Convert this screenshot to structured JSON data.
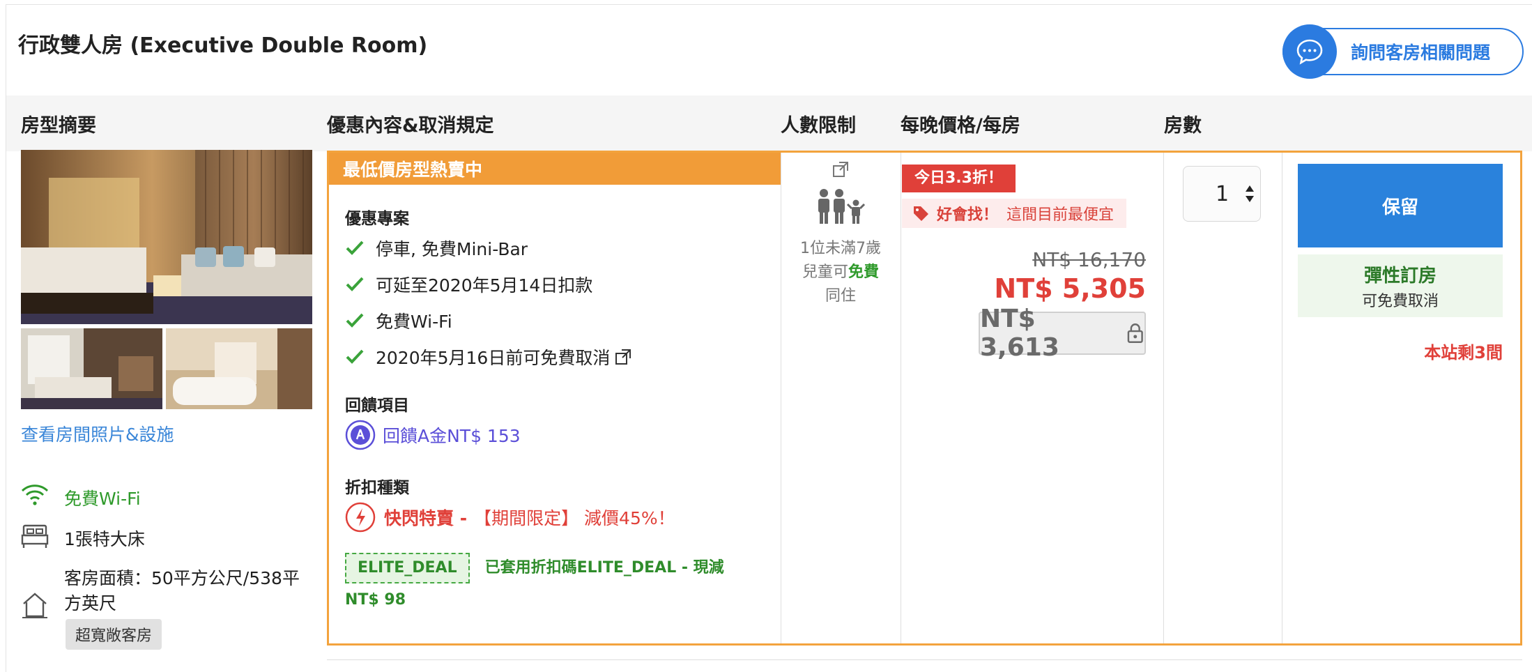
{
  "room": {
    "title": "行政雙人房 (Executive Double Room)",
    "ask_label": "詢問客房相關問題"
  },
  "columns": {
    "summary": "房型摘要",
    "offers": "優惠內容&取消規定",
    "persons": "人數限制",
    "price": "每晚價格/每房",
    "rooms": "房數"
  },
  "summary": {
    "view_photos": "查看房間照片&設施",
    "amenities": [
      "免費Wi-Fi",
      "1張特大床",
      "客房面積：50平方公尺/538平方英尺"
    ],
    "area_tag": "超寬敞客房"
  },
  "offer": {
    "banner": "最低價房型熱賣中",
    "benefits_title": "優惠專案",
    "benefits": [
      "停車, 免費Mini-Bar",
      "可延至2020年5月14日扣款",
      "免費Wi-Fi",
      "2020年5月16日前可免費取消"
    ],
    "cashback_title": "回饋項目",
    "cashback": "回饋A金NT$ 153",
    "discount_title": "折扣種類",
    "discount_flash": "快閃特賣 -",
    "discount_detail": "【期間限定】 減價45%！",
    "coupon_code": "ELITE_DEAL",
    "coupon_text": "已套用折扣碼ELITE_DEAL - 現減",
    "coupon_amount": "NT$ 98"
  },
  "persons": {
    "note_line1": "1位未滿7歲",
    "note_line2_prefix": "兒童可",
    "note_free": "免費",
    "note_line3": "同住"
  },
  "price": {
    "promo_tag": "今日3.3折！",
    "best_label": "好會找！",
    "best_text": "這間目前最便宜",
    "original": "NT$ 16,170",
    "current": "NT$ 5,305",
    "member": "NT$ 3,613"
  },
  "booking": {
    "quantity": "1",
    "reserve_label": "保留",
    "flex_title": "彈性訂房",
    "flex_sub": "可免費取消",
    "rooms_left": "本站剩3間"
  },
  "colors": {
    "accent_blue": "#2a82dc",
    "banner_orange": "#f19c38",
    "price_red": "#e04039",
    "success_green": "#2f9a2b"
  }
}
